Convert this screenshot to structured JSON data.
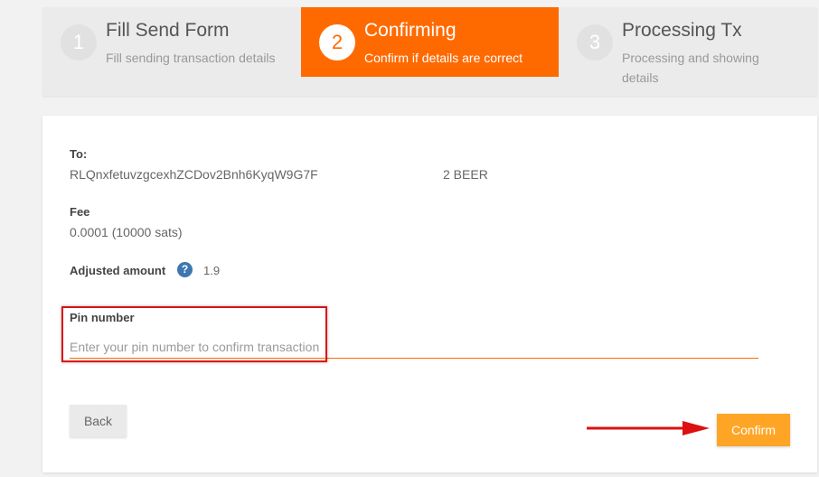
{
  "steps": [
    {
      "number": "1",
      "title": "Fill Send Form",
      "subtitle": "Fill sending transaction details"
    },
    {
      "number": "2",
      "title": "Confirming",
      "subtitle": "Confirm if details are correct"
    },
    {
      "number": "3",
      "title": "Processing Tx",
      "subtitle": "Processing and showing details"
    }
  ],
  "details": {
    "to_label": "To:",
    "to_address": "RLQnxfetuvzgcexhZCDov2Bnh6KyqW9G7F",
    "to_amount": "2 BEER",
    "fee_label": "Fee",
    "fee_value": "0.0001 (10000 sats)",
    "adjusted_label": "Adjusted amount",
    "adjusted_value": "1.9",
    "help_icon": "?"
  },
  "pin": {
    "label": "Pin number",
    "placeholder": "Enter your pin number to confirm transaction",
    "value": ""
  },
  "buttons": {
    "back": "Back",
    "confirm": "Confirm"
  },
  "colors": {
    "accent": "#ff6a00",
    "confirm": "#ffa526",
    "annotation": "#dd1111"
  }
}
